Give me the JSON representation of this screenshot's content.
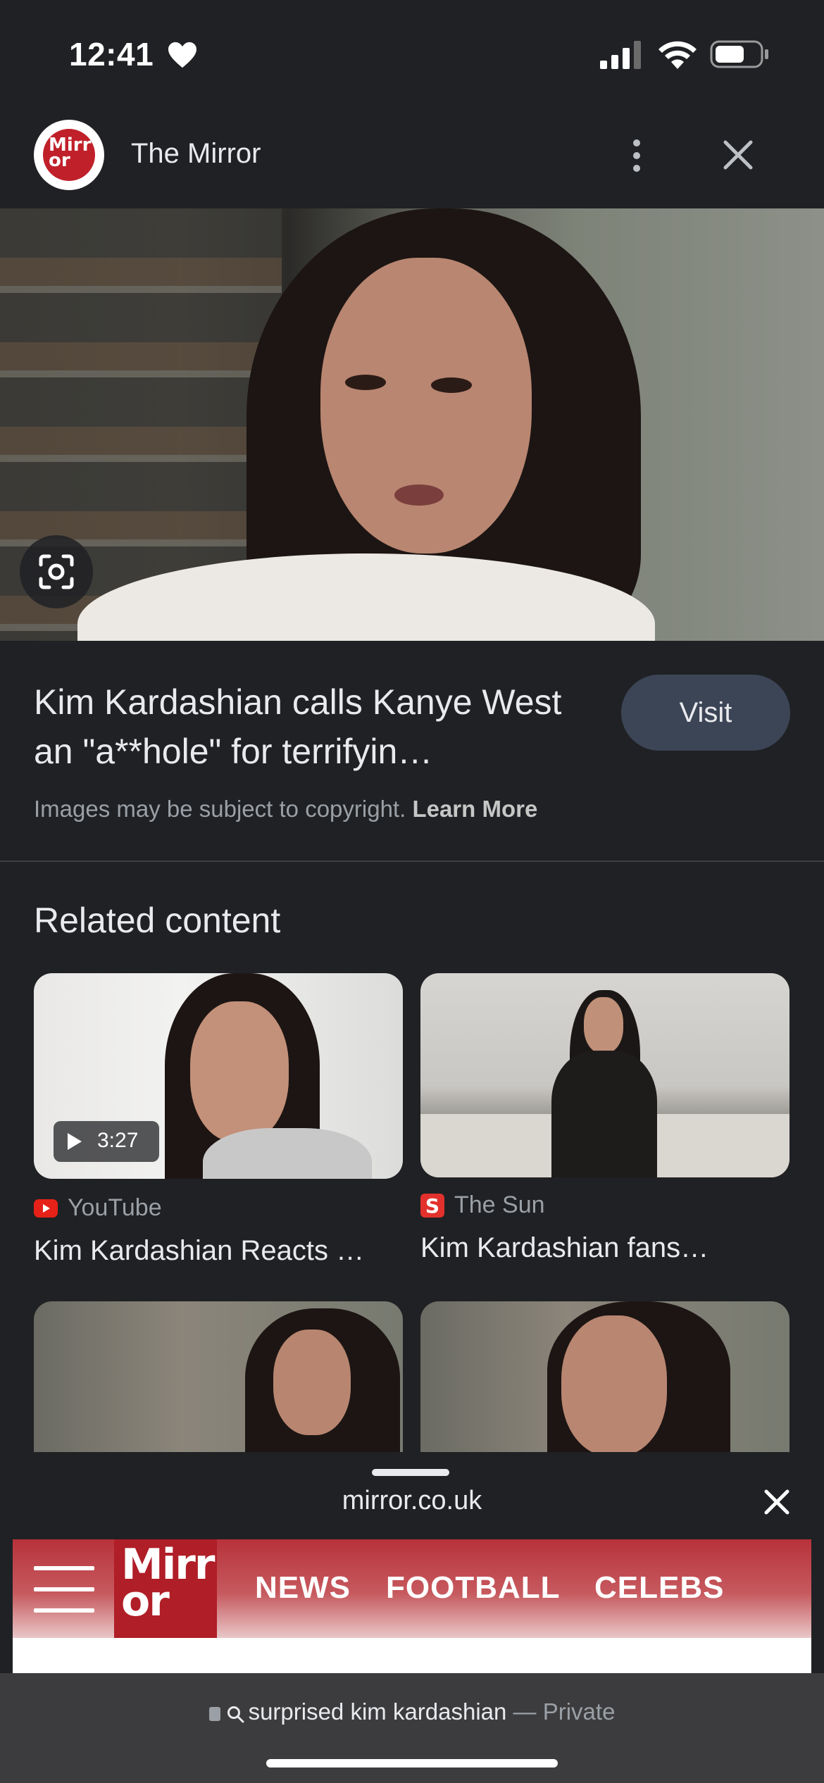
{
  "status_bar": {
    "time": "12:41"
  },
  "header": {
    "site_name": "The Mirror",
    "logo_text": "Mirr\nor"
  },
  "result": {
    "title": "Kim Kardashian calls Kanye West an \"a**hole\" for terrifyin…",
    "visit_label": "Visit",
    "copyright_text": "Images may be subject to copyright.",
    "learn_more": "Learn More"
  },
  "related": {
    "heading": "Related content",
    "items": [
      {
        "source": "YouTube",
        "title": "Kim Kardashian Reacts …",
        "duration": "3:27",
        "source_color": "#e62117"
      },
      {
        "source": "The Sun",
        "title": "Kim Kardashian fans…",
        "source_color": "#e2312c"
      }
    ]
  },
  "sheet": {
    "url": "mirror.co.uk",
    "logo_text": "Mirr\nor",
    "nav": [
      "NEWS",
      "FOOTBALL",
      "CELEBS"
    ]
  },
  "url_bar": {
    "query": "surprised kim kardashian",
    "mode": " — Private"
  },
  "colors": {
    "background": "#202124",
    "visit_button": "#3c4556",
    "mirror_red": "#b8323a"
  }
}
